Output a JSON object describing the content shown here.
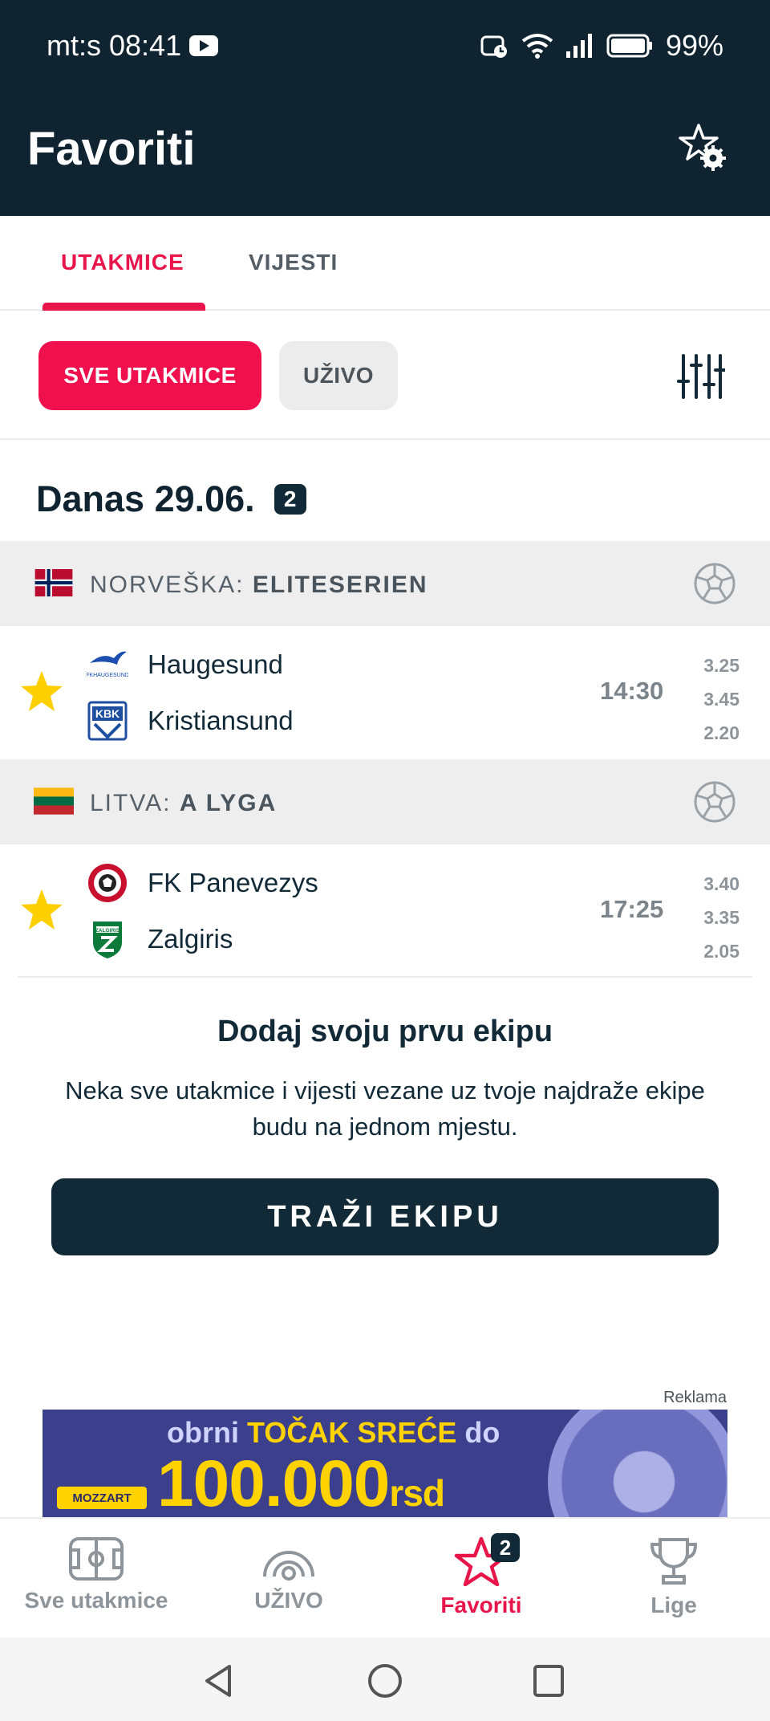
{
  "status_bar": {
    "carrier": "mt:s",
    "time": "08:41",
    "battery": "99%",
    "icons": [
      "youtube-icon",
      "alarm-icon",
      "wifi-icon",
      "signal-icon",
      "battery-icon"
    ]
  },
  "header": {
    "title": "Favoriti",
    "settings_icon": "star-gear-icon"
  },
  "tabs": [
    {
      "label": "UTAKMICE",
      "active": true
    },
    {
      "label": "VIJESTI",
      "active": false
    }
  ],
  "filters": {
    "all_label": "SVE UTAKMICE",
    "live_label": "UŽIVO",
    "filter_icon": "sliders-icon"
  },
  "date_section": {
    "label": "Danas 29.06.",
    "count": "2"
  },
  "leagues": [
    {
      "country": "NORVEŠKA:",
      "name": "ELITESERIEN",
      "flag": "norway-flag",
      "match": {
        "home": "Haugesund",
        "away": "Kristiansund",
        "time": "14:30",
        "odds": [
          "3.25",
          "3.45",
          "2.20"
        ]
      }
    },
    {
      "country": "LITVA:",
      "name": "A LYGA",
      "flag": "lithuania-flag",
      "match": {
        "home": "FK Panevezys",
        "away": "Zalgiris",
        "time": "17:25",
        "odds": [
          "3.40",
          "3.35",
          "2.05"
        ]
      }
    }
  ],
  "empty_state": {
    "title": "Dodaj svoju prvu ekipu",
    "text": "Neka sve utakmice i vijesti vezane uz tvoje najdraže ekipe budu na jednom mjestu.",
    "button": "TRAŽI EKIPU"
  },
  "ad": {
    "label": "Reklama",
    "line1_a": "obrni",
    "line1_b": "TOČAK SREĆE",
    "line1_c": "do",
    "amount": "100.000",
    "currency": "rsd",
    "brand": "MOZZART"
  },
  "bottom_nav": [
    {
      "label": "Sve utakmice",
      "icon": "pitch-icon",
      "active": false
    },
    {
      "label": "UŽIVO",
      "icon": "live-broadcast-icon",
      "active": false
    },
    {
      "label": "Favoriti",
      "icon": "star-icon",
      "active": true,
      "badge": "2"
    },
    {
      "label": "Lige",
      "icon": "trophy-icon",
      "active": false
    }
  ],
  "colors": {
    "accent": "#e8154b",
    "dark": "#0f2430",
    "star": "#ffd000"
  }
}
